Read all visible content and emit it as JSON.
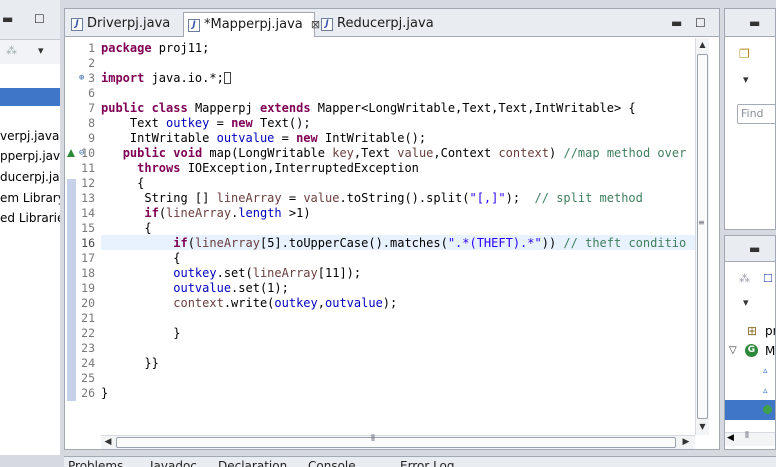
{
  "left_panel": {
    "items": [
      "verpj.java",
      "pperpj.jav",
      "ducerpj.ja",
      "em Library",
      "ed Librarie"
    ]
  },
  "editor": {
    "tabs": [
      {
        "label": "Driverpj.java",
        "active": false,
        "dirty": false
      },
      {
        "label": "*Mapperpj.java",
        "active": true,
        "dirty": true
      },
      {
        "label": "Reducerpj.java",
        "active": false,
        "dirty": false
      }
    ],
    "close_glyph": "⊠",
    "current_line": "16",
    "lines": [
      {
        "n": "1",
        "segs": [
          {
            "t": "package",
            "c": "kw"
          },
          {
            "t": " proj11;",
            "c": ""
          }
        ]
      },
      {
        "n": "2",
        "segs": []
      },
      {
        "n": "3",
        "segs": [
          {
            "t": "import",
            "c": "kw"
          },
          {
            "t": " java.io.*;",
            "c": ""
          }
        ],
        "fold": "⊕",
        "collapsed": true
      },
      {
        "n": "6",
        "segs": []
      },
      {
        "n": "7",
        "segs": [
          {
            "t": "public",
            "c": "kw"
          },
          {
            "t": " ",
            "c": ""
          },
          {
            "t": "class",
            "c": "kw"
          },
          {
            "t": " Mapperpj ",
            "c": ""
          },
          {
            "t": "extends",
            "c": "kw"
          },
          {
            "t": " Mapper<LongWritable,Text,Text,IntWritable> {",
            "c": ""
          }
        ]
      },
      {
        "n": "8",
        "segs": [
          {
            "t": "    Text ",
            "c": ""
          },
          {
            "t": "outkey",
            "c": "fld"
          },
          {
            "t": " = ",
            "c": ""
          },
          {
            "t": "new",
            "c": "kw"
          },
          {
            "t": " Text();",
            "c": ""
          }
        ]
      },
      {
        "n": "9",
        "segs": [
          {
            "t": "    IntWritable ",
            "c": ""
          },
          {
            "t": "outvalue",
            "c": "fld"
          },
          {
            "t": " = ",
            "c": ""
          },
          {
            "t": "new",
            "c": "kw"
          },
          {
            "t": " IntWritable();",
            "c": ""
          }
        ]
      },
      {
        "n": "10",
        "segs": [
          {
            "t": "   ",
            "c": ""
          },
          {
            "t": "public",
            "c": "kw"
          },
          {
            "t": " ",
            "c": ""
          },
          {
            "t": "void",
            "c": "kw"
          },
          {
            "t": " map(LongWritable ",
            "c": ""
          },
          {
            "t": "key",
            "c": "prm"
          },
          {
            "t": ",Text ",
            "c": ""
          },
          {
            "t": "value",
            "c": "prm"
          },
          {
            "t": ",Context ",
            "c": ""
          },
          {
            "t": "context",
            "c": "prm"
          },
          {
            "t": ") ",
            "c": ""
          },
          {
            "t": "//map method over",
            "c": "cmt"
          }
        ],
        "fold": "⊖",
        "override": true
      },
      {
        "n": "11",
        "segs": [
          {
            "t": "     ",
            "c": ""
          },
          {
            "t": "throws",
            "c": "kw"
          },
          {
            "t": " IOException,InterruptedException",
            "c": ""
          }
        ]
      },
      {
        "n": "12",
        "segs": [
          {
            "t": "     {",
            "c": ""
          }
        ]
      },
      {
        "n": "13",
        "segs": [
          {
            "t": "      String [] ",
            "c": ""
          },
          {
            "t": "lineArray",
            "c": "prm"
          },
          {
            "t": " = ",
            "c": ""
          },
          {
            "t": "value",
            "c": "prm"
          },
          {
            "t": ".toString().split(",
            "c": ""
          },
          {
            "t": "\"[,]\"",
            "c": "str"
          },
          {
            "t": ");  ",
            "c": ""
          },
          {
            "t": "// split method",
            "c": "cmt"
          }
        ]
      },
      {
        "n": "14",
        "segs": [
          {
            "t": "      ",
            "c": ""
          },
          {
            "t": "if",
            "c": "kw"
          },
          {
            "t": "(",
            "c": ""
          },
          {
            "t": "lineArray",
            "c": "prm"
          },
          {
            "t": ".",
            "c": ""
          },
          {
            "t": "length",
            "c": "fld"
          },
          {
            "t": " >1)",
            "c": ""
          }
        ]
      },
      {
        "n": "15",
        "segs": [
          {
            "t": "      {",
            "c": ""
          }
        ]
      },
      {
        "n": "16",
        "segs": [
          {
            "t": "          ",
            "c": ""
          },
          {
            "t": "if",
            "c": "kw"
          },
          {
            "t": "(",
            "c": ""
          },
          {
            "t": "lineArray",
            "c": "prm"
          },
          {
            "t": "[5].toUpperCase().matches(",
            "c": ""
          },
          {
            "t": "\".*(THEFT).*\"",
            "c": "str"
          },
          {
            "t": ")) ",
            "c": ""
          },
          {
            "t": "// theft conditio",
            "c": "cmt"
          }
        ]
      },
      {
        "n": "17",
        "segs": [
          {
            "t": "          {",
            "c": ""
          }
        ]
      },
      {
        "n": "18",
        "segs": [
          {
            "t": "          ",
            "c": ""
          },
          {
            "t": "outkey",
            "c": "fld"
          },
          {
            "t": ".set(",
            "c": ""
          },
          {
            "t": "lineArray",
            "c": "prm"
          },
          {
            "t": "[11]);",
            "c": ""
          }
        ]
      },
      {
        "n": "19",
        "segs": [
          {
            "t": "          ",
            "c": ""
          },
          {
            "t": "outvalue",
            "c": "fld"
          },
          {
            "t": ".set(1);",
            "c": ""
          }
        ]
      },
      {
        "n": "20",
        "segs": [
          {
            "t": "          ",
            "c": ""
          },
          {
            "t": "context",
            "c": "prm"
          },
          {
            "t": ".write(",
            "c": ""
          },
          {
            "t": "outkey",
            "c": "fld"
          },
          {
            "t": ",",
            "c": ""
          },
          {
            "t": "outvalue",
            "c": "fld"
          },
          {
            "t": ");",
            "c": ""
          }
        ]
      },
      {
        "n": "21",
        "segs": []
      },
      {
        "n": "22",
        "segs": [
          {
            "t": "          }",
            "c": ""
          }
        ]
      },
      {
        "n": "23",
        "segs": []
      },
      {
        "n": "24",
        "segs": [
          {
            "t": "      }}",
            "c": ""
          }
        ]
      },
      {
        "n": "25",
        "segs": []
      },
      {
        "n": "26",
        "segs": [
          {
            "t": "}",
            "c": ""
          }
        ]
      }
    ]
  },
  "outline": {
    "find_placeholder": "Find",
    "rows": [
      {
        "icon": "package-icon",
        "glyph": "⊞",
        "label": "pr"
      },
      {
        "icon": "class-icon",
        "glyph": "G",
        "label": "M"
      }
    ]
  },
  "bottom_tabs": [
    "Problems",
    "Javadoc",
    "Declaration",
    "Console",
    "Error Log"
  ],
  "colors": {
    "keyword": "#7f0055",
    "field": "#0000c0",
    "parameter": "#6a3e3e",
    "string": "#2a00ff",
    "comment": "#3f7f5f",
    "current_line_bg": "#e8f2fe",
    "selection": "#3f76c8"
  }
}
